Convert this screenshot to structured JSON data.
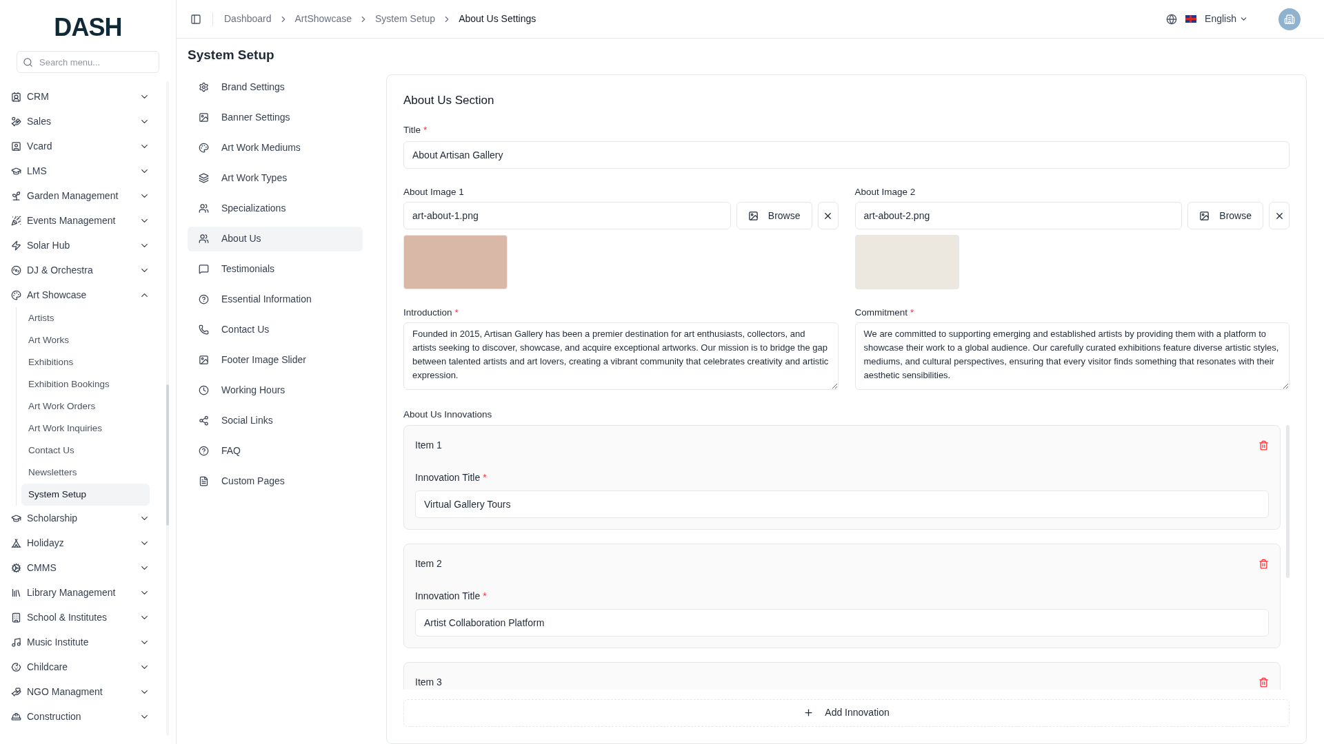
{
  "brand": {
    "logo": "DASH"
  },
  "sidebar": {
    "search_placeholder": "Search menu...",
    "items": [
      {
        "label": "CRM",
        "expanded": false
      },
      {
        "label": "Sales",
        "expanded": false
      },
      {
        "label": "Vcard",
        "expanded": false
      },
      {
        "label": "LMS",
        "expanded": false
      },
      {
        "label": "Garden Management",
        "expanded": false
      },
      {
        "label": "Events Management",
        "expanded": false
      },
      {
        "label": "Solar Hub",
        "expanded": false
      },
      {
        "label": "DJ & Orchestra",
        "expanded": false
      },
      {
        "label": "Art Showcase",
        "expanded": true,
        "children": [
          {
            "label": "Artists",
            "selected": false
          },
          {
            "label": "Art Works",
            "selected": false
          },
          {
            "label": "Exhibitions",
            "selected": false
          },
          {
            "label": "Exhibition Bookings",
            "selected": false
          },
          {
            "label": "Art Work Orders",
            "selected": false
          },
          {
            "label": "Art Work Inquiries",
            "selected": false
          },
          {
            "label": "Contact Us",
            "selected": false
          },
          {
            "label": "Newsletters",
            "selected": false
          },
          {
            "label": "System Setup",
            "selected": true
          }
        ]
      },
      {
        "label": "Scholarship",
        "expanded": false
      },
      {
        "label": "Holidayz",
        "expanded": false
      },
      {
        "label": "CMMS",
        "expanded": false
      },
      {
        "label": "Library Management",
        "expanded": false
      },
      {
        "label": "School & Institutes",
        "expanded": false
      },
      {
        "label": "Music Institute",
        "expanded": false
      },
      {
        "label": "Childcare",
        "expanded": false
      },
      {
        "label": "NGO Managment",
        "expanded": false
      },
      {
        "label": "Construction",
        "expanded": false
      }
    ]
  },
  "header": {
    "breadcrumbs": [
      "Dashboard",
      "ArtShowcase",
      "System Setup",
      "About Us Settings"
    ],
    "language": "English"
  },
  "setup_menu": {
    "title": "System Setup",
    "items": [
      {
        "label": "Brand Settings",
        "selected": false
      },
      {
        "label": "Banner Settings",
        "selected": false
      },
      {
        "label": "Art Work Mediums",
        "selected": false
      },
      {
        "label": "Art Work Types",
        "selected": false
      },
      {
        "label": "Specializations",
        "selected": false
      },
      {
        "label": "About Us",
        "selected": true
      },
      {
        "label": "Testimonials",
        "selected": false
      },
      {
        "label": "Essential Information",
        "selected": false
      },
      {
        "label": "Contact Us",
        "selected": false
      },
      {
        "label": "Footer Image Slider",
        "selected": false
      },
      {
        "label": "Working Hours",
        "selected": false
      },
      {
        "label": "Social Links",
        "selected": false
      },
      {
        "label": "FAQ",
        "selected": false
      },
      {
        "label": "Custom Pages",
        "selected": false
      }
    ]
  },
  "form": {
    "title": "About Us Section",
    "title_field": {
      "label": "Title",
      "required_mark": "*",
      "value": "About Artisan Gallery"
    },
    "images": [
      {
        "label": "About Image 1",
        "value": "art-about-1.png",
        "button": "Browse"
      },
      {
        "label": "About Image 2",
        "value": "art-about-2.png",
        "button": "Browse"
      }
    ],
    "texts": [
      {
        "label": "Introduction",
        "required_mark": "*",
        "value": "Founded in 2015, Artisan Gallery has been a premier destination for art enthusiasts, collectors, and artists seeking to discover, showcase, and acquire exceptional artworks. Our mission is to bridge the gap between talented artists and art lovers, creating a vibrant community that celebrates creativity and artistic expression."
      },
      {
        "label": "Commitment",
        "required_mark": "*",
        "value": "We are committed to supporting emerging and established artists by providing them with a platform to showcase their work to a global audience. Our carefully curated exhibitions feature diverse artistic styles, mediums, and cultural perspectives, ensuring that every visitor finds something that resonates with their aesthetic sensibilities."
      }
    ],
    "innovations": {
      "label": "About Us Innovations",
      "items": [
        {
          "title": "Item 1",
          "field_label": "Innovation Title",
          "required_mark": "*",
          "value": "Virtual Gallery Tours"
        },
        {
          "title": "Item 2",
          "field_label": "Innovation Title",
          "required_mark": "*",
          "value": "Artist Collaboration Platform"
        },
        {
          "title": "Item 3"
        }
      ],
      "add_button": "Add Innovation"
    }
  }
}
